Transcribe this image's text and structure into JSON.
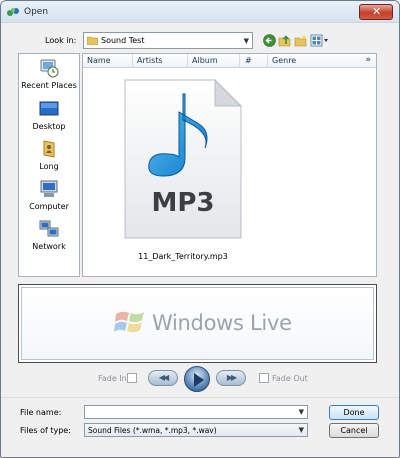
{
  "window": {
    "title": "Open",
    "close_glyph": "✕"
  },
  "lookin": {
    "label": "Look in:",
    "value": "Sound Test"
  },
  "toolbar": {
    "icons": [
      "back-icon",
      "up-folder-icon",
      "new-folder-icon",
      "views-icon"
    ]
  },
  "places": [
    {
      "label": "Recent Places",
      "icon": "recent-places-icon"
    },
    {
      "label": "Desktop",
      "icon": "desktop-icon"
    },
    {
      "label": "Long",
      "icon": "user-folder-icon"
    },
    {
      "label": "Computer",
      "icon": "computer-icon"
    },
    {
      "label": "Network",
      "icon": "network-icon"
    }
  ],
  "columns": [
    "Name",
    "Artists",
    "Album",
    "#",
    "Genre"
  ],
  "more_columns_glyph": "»",
  "files": [
    {
      "name": "11_Dark_Territory.mp3",
      "badge": "MP3",
      "icon": "mp3-file-icon"
    }
  ],
  "preview": {
    "brand": "Windows Live"
  },
  "player": {
    "fade_in_label": "Fade In",
    "fade_out_label": "Fade Out",
    "rewind_glyph": "◀◀",
    "forward_glyph": "▶▶"
  },
  "form": {
    "filename_label": "File name:",
    "filename_value": "",
    "filetype_label": "Files of type:",
    "filetype_value": "Sound Files (*.wma, *.mp3, *.wav)"
  },
  "buttons": {
    "done": "Done",
    "cancel": "Cancel"
  },
  "colors": {
    "accent": "#2a7fd4",
    "close_red": "#c4402b",
    "muted": "#9aa4ae"
  }
}
